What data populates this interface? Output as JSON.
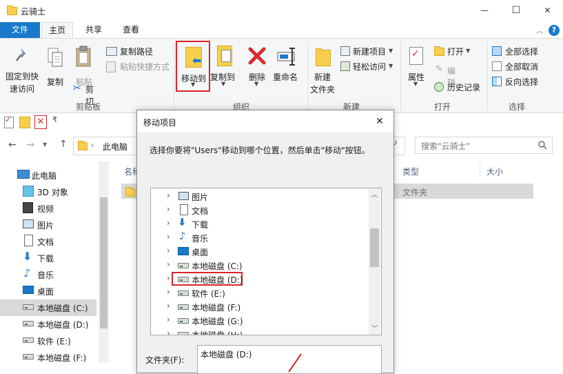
{
  "window": {
    "title": "云骑士",
    "controls": [
      "—",
      "☐",
      "✕"
    ]
  },
  "menu_tabs": {
    "file": "文件",
    "home": "主页",
    "share": "共享",
    "view": "查看"
  },
  "ribbon": {
    "clipboard": {
      "pin_label": "固定到快速访问",
      "pin_line1": "固定到快",
      "pin_line2": "速访问",
      "copy": "复制",
      "paste": "粘贴",
      "copy_path": "复制路径",
      "paste_shortcut": "粘贴快捷方式",
      "cut": "剪切",
      "group": "剪贴板"
    },
    "organize": {
      "move_to": "移动到",
      "copy_to": "复制到",
      "delete": "删除",
      "rename": "重命名",
      "group": "组织"
    },
    "new": {
      "new_folder_line1": "新建",
      "new_folder_line2": "文件夹",
      "new_item": "新建项目",
      "easy_access": "轻松访问",
      "group": "新建"
    },
    "open": {
      "properties": "属性",
      "open": "打开",
      "edit": "编辑",
      "history": "历史记录",
      "group": "打开"
    },
    "select": {
      "select_all": "全部选择",
      "select_none": "全部取消",
      "invert": "反向选择",
      "group": "选择"
    }
  },
  "address_bar": {
    "crumb": "此电脑",
    "search_placeholder": "搜索\"云骑士\""
  },
  "columns": {
    "name": "名称",
    "type": "类型",
    "size": "大小"
  },
  "file_row": {
    "type": "文件夹"
  },
  "sidebar": {
    "items": [
      {
        "label": "此电脑",
        "icon": "computer-icon"
      },
      {
        "label": "3D 对象",
        "icon": "3d-objects-icon"
      },
      {
        "label": "视频",
        "icon": "video-icon"
      },
      {
        "label": "图片",
        "icon": "pictures-icon"
      },
      {
        "label": "文档",
        "icon": "documents-icon"
      },
      {
        "label": "下载",
        "icon": "download-icon"
      },
      {
        "label": "音乐",
        "icon": "music-icon"
      },
      {
        "label": "桌面",
        "icon": "desktop-icon"
      },
      {
        "label": "本地磁盘 (C:)",
        "icon": "drive-c-icon"
      },
      {
        "label": "本地磁盘 (D:)",
        "icon": "drive-icon"
      },
      {
        "label": "软件 (E:)",
        "icon": "drive-icon"
      },
      {
        "label": "本地磁盘 (F:)",
        "icon": "drive-icon"
      }
    ]
  },
  "dialog": {
    "title": "移动项目",
    "instruction": "选择你要将\"Users\"移动到哪个位置，然后单击\"移动\"按钮。",
    "tree": [
      {
        "label": "图片",
        "icon": "pictures-icon"
      },
      {
        "label": "文档",
        "icon": "documents-icon"
      },
      {
        "label": "下载",
        "icon": "download-icon"
      },
      {
        "label": "音乐",
        "icon": "music-icon"
      },
      {
        "label": "桌面",
        "icon": "desktop-icon"
      },
      {
        "label": "本地磁盘 (C:)",
        "icon": "drive-c-icon"
      },
      {
        "label": "本地磁盘 (D:)",
        "icon": "drive-icon",
        "highlighted": true
      },
      {
        "label": "软件 (E:)",
        "icon": "drive-icon"
      },
      {
        "label": "本地磁盘 (F:)",
        "icon": "drive-icon"
      },
      {
        "label": "本地磁盘 (G:)",
        "icon": "drive-icon"
      },
      {
        "label": "本地磁盘 (H:)",
        "icon": "drive-icon"
      }
    ],
    "folder_label": "文件夹(F):",
    "folder_value": "本地磁盘 (D:)"
  },
  "colors": {
    "file_tab": "#1979ca",
    "highlight": "#d9232a",
    "selected_row": "#cce8ff",
    "delete_red": "#d92b2b"
  }
}
